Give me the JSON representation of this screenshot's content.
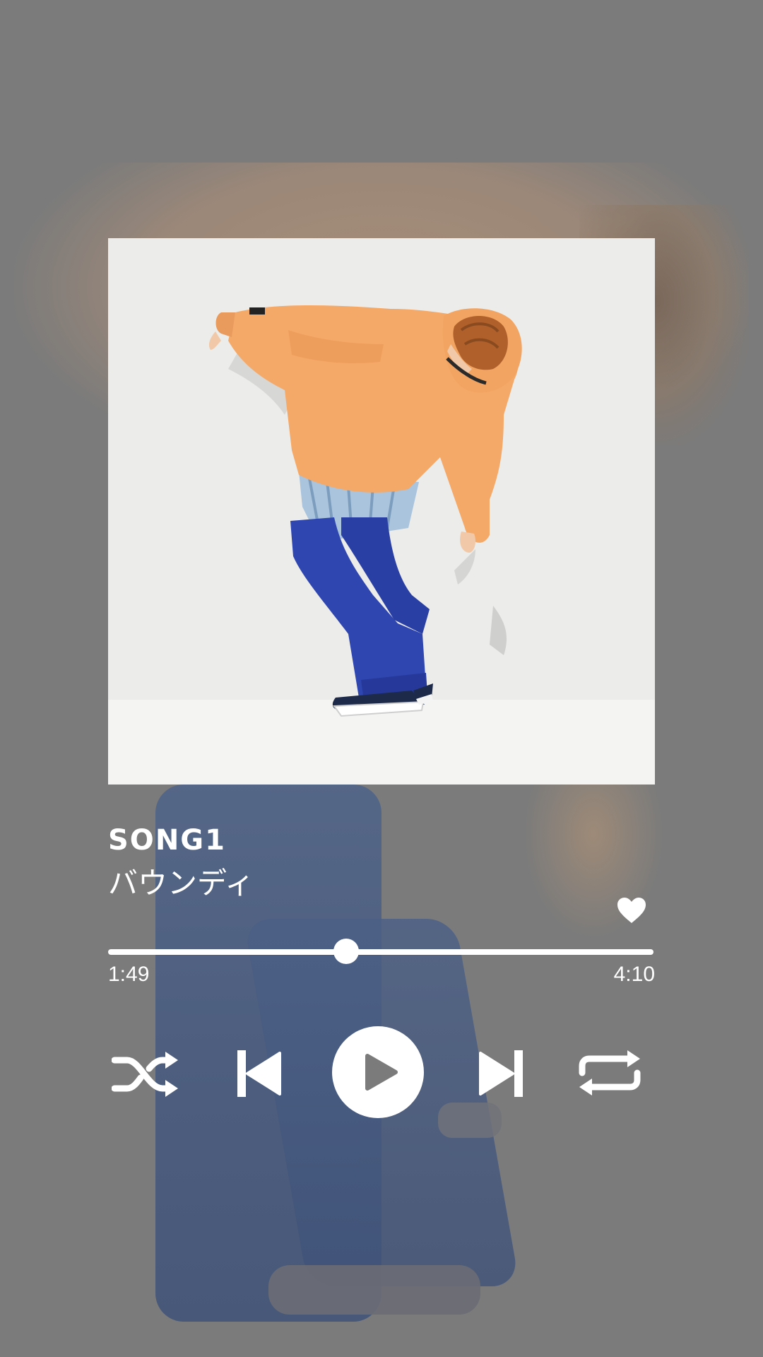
{
  "track": {
    "title": "SONG1",
    "artist": "バウンディ"
  },
  "playback": {
    "elapsed": "1:49",
    "duration": "4:10",
    "progress_fraction": 0.436,
    "liked": true,
    "state": "paused"
  },
  "icons": {
    "like": "heart-icon",
    "shuffle": "shuffle-icon",
    "previous": "skip-previous-icon",
    "play": "play-icon",
    "next": "skip-next-icon",
    "repeat": "repeat-icon"
  },
  "colors": {
    "background": "#7b7b7b",
    "foreground": "#ffffff",
    "cover_background": "#ececea",
    "hoodie": "#f5a968",
    "pants": "#2f46b0"
  }
}
